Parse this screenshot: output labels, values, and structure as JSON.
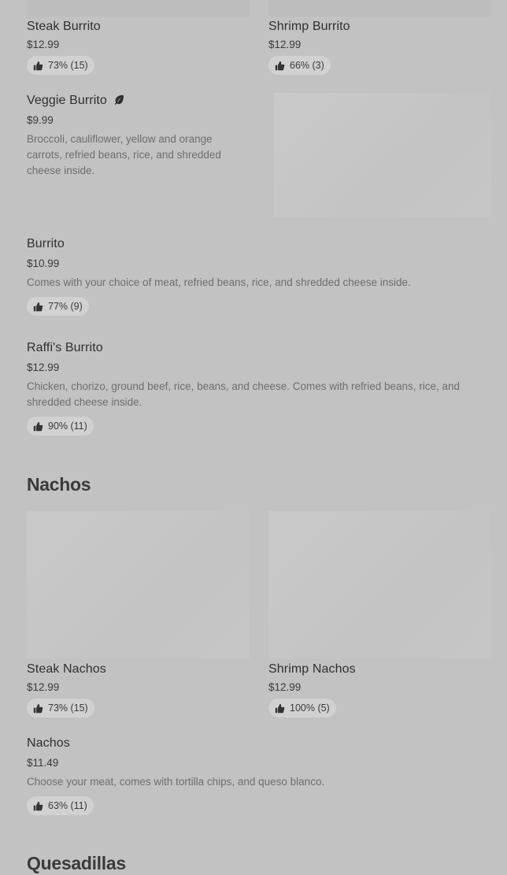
{
  "items": {
    "steak_burrito": {
      "name": "Steak Burrito",
      "price": "$12.99",
      "rating": "73% (15)"
    },
    "shrimp_burrito": {
      "name": "Shrimp Burrito",
      "price": "$12.99",
      "rating": "66% (3)"
    },
    "veggie_burrito": {
      "name": "Veggie Burrito",
      "price": "$9.99",
      "description": "Broccoli, cauliflower, yellow and orange carrots, refried beans, rice, and shredded cheese inside."
    },
    "burrito": {
      "name": "Burrito",
      "price": "$10.99",
      "description": "Comes with your choice of meat, refried beans, rice, and shredded cheese inside.",
      "rating": "77% (9)"
    },
    "raffis_burrito": {
      "name": "Raffi's Burrito",
      "price": "$12.99",
      "description": "Chicken, chorizo, ground beef, rice, beans, and cheese. Comes with refried beans, rice, and shredded cheese inside.",
      "rating": "90% (11)"
    },
    "steak_nachos": {
      "name": "Steak Nachos",
      "price": "$12.99",
      "rating": "73% (15)"
    },
    "shrimp_nachos": {
      "name": "Shrimp Nachos",
      "price": "$12.99",
      "rating": "100% (5)"
    },
    "nachos": {
      "name": "Nachos",
      "price": "$11.49",
      "description": "Choose your meat, comes with tortilla chips, and queso blanco.",
      "rating": "63% (11)"
    }
  },
  "sections": {
    "nachos": "Nachos",
    "quesadillas": "Quesadillas"
  },
  "icons": {
    "rating": "thumbs-up-icon",
    "vegetarian": "leaf-icon"
  },
  "colors": {
    "background": "#c2c2c2",
    "badge": "#d1d1d1"
  }
}
